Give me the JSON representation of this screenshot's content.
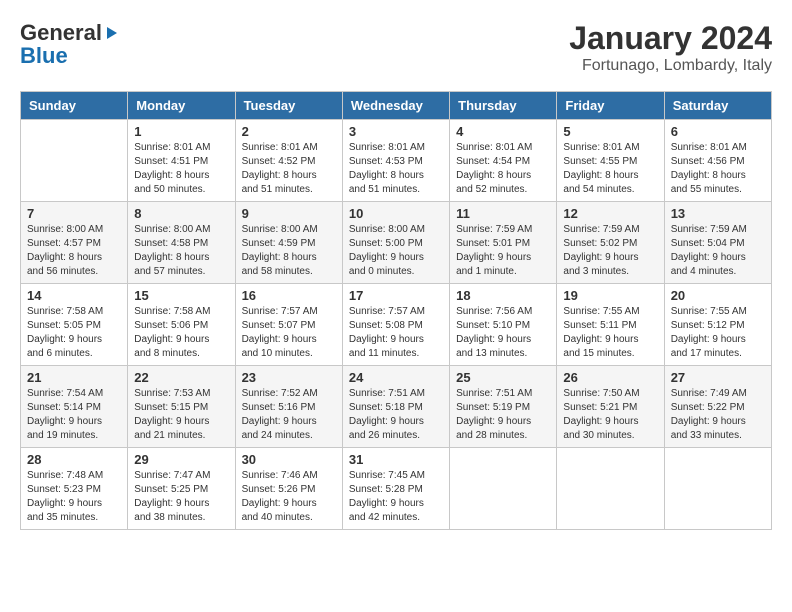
{
  "header": {
    "logo_general": "General",
    "logo_blue": "Blue",
    "month_title": "January 2024",
    "location": "Fortunago, Lombardy, Italy"
  },
  "weekdays": [
    "Sunday",
    "Monday",
    "Tuesday",
    "Wednesday",
    "Thursday",
    "Friday",
    "Saturday"
  ],
  "weeks": [
    [
      {
        "day": "",
        "info": ""
      },
      {
        "day": "1",
        "info": "Sunrise: 8:01 AM\nSunset: 4:51 PM\nDaylight: 8 hours\nand 50 minutes."
      },
      {
        "day": "2",
        "info": "Sunrise: 8:01 AM\nSunset: 4:52 PM\nDaylight: 8 hours\nand 51 minutes."
      },
      {
        "day": "3",
        "info": "Sunrise: 8:01 AM\nSunset: 4:53 PM\nDaylight: 8 hours\nand 51 minutes."
      },
      {
        "day": "4",
        "info": "Sunrise: 8:01 AM\nSunset: 4:54 PM\nDaylight: 8 hours\nand 52 minutes."
      },
      {
        "day": "5",
        "info": "Sunrise: 8:01 AM\nSunset: 4:55 PM\nDaylight: 8 hours\nand 54 minutes."
      },
      {
        "day": "6",
        "info": "Sunrise: 8:01 AM\nSunset: 4:56 PM\nDaylight: 8 hours\nand 55 minutes."
      }
    ],
    [
      {
        "day": "7",
        "info": "Sunrise: 8:00 AM\nSunset: 4:57 PM\nDaylight: 8 hours\nand 56 minutes."
      },
      {
        "day": "8",
        "info": "Sunrise: 8:00 AM\nSunset: 4:58 PM\nDaylight: 8 hours\nand 57 minutes."
      },
      {
        "day": "9",
        "info": "Sunrise: 8:00 AM\nSunset: 4:59 PM\nDaylight: 8 hours\nand 58 minutes."
      },
      {
        "day": "10",
        "info": "Sunrise: 8:00 AM\nSunset: 5:00 PM\nDaylight: 9 hours\nand 0 minutes."
      },
      {
        "day": "11",
        "info": "Sunrise: 7:59 AM\nSunset: 5:01 PM\nDaylight: 9 hours\nand 1 minute."
      },
      {
        "day": "12",
        "info": "Sunrise: 7:59 AM\nSunset: 5:02 PM\nDaylight: 9 hours\nand 3 minutes."
      },
      {
        "day": "13",
        "info": "Sunrise: 7:59 AM\nSunset: 5:04 PM\nDaylight: 9 hours\nand 4 minutes."
      }
    ],
    [
      {
        "day": "14",
        "info": "Sunrise: 7:58 AM\nSunset: 5:05 PM\nDaylight: 9 hours\nand 6 minutes."
      },
      {
        "day": "15",
        "info": "Sunrise: 7:58 AM\nSunset: 5:06 PM\nDaylight: 9 hours\nand 8 minutes."
      },
      {
        "day": "16",
        "info": "Sunrise: 7:57 AM\nSunset: 5:07 PM\nDaylight: 9 hours\nand 10 minutes."
      },
      {
        "day": "17",
        "info": "Sunrise: 7:57 AM\nSunset: 5:08 PM\nDaylight: 9 hours\nand 11 minutes."
      },
      {
        "day": "18",
        "info": "Sunrise: 7:56 AM\nSunset: 5:10 PM\nDaylight: 9 hours\nand 13 minutes."
      },
      {
        "day": "19",
        "info": "Sunrise: 7:55 AM\nSunset: 5:11 PM\nDaylight: 9 hours\nand 15 minutes."
      },
      {
        "day": "20",
        "info": "Sunrise: 7:55 AM\nSunset: 5:12 PM\nDaylight: 9 hours\nand 17 minutes."
      }
    ],
    [
      {
        "day": "21",
        "info": "Sunrise: 7:54 AM\nSunset: 5:14 PM\nDaylight: 9 hours\nand 19 minutes."
      },
      {
        "day": "22",
        "info": "Sunrise: 7:53 AM\nSunset: 5:15 PM\nDaylight: 9 hours\nand 21 minutes."
      },
      {
        "day": "23",
        "info": "Sunrise: 7:52 AM\nSunset: 5:16 PM\nDaylight: 9 hours\nand 24 minutes."
      },
      {
        "day": "24",
        "info": "Sunrise: 7:51 AM\nSunset: 5:18 PM\nDaylight: 9 hours\nand 26 minutes."
      },
      {
        "day": "25",
        "info": "Sunrise: 7:51 AM\nSunset: 5:19 PM\nDaylight: 9 hours\nand 28 minutes."
      },
      {
        "day": "26",
        "info": "Sunrise: 7:50 AM\nSunset: 5:21 PM\nDaylight: 9 hours\nand 30 minutes."
      },
      {
        "day": "27",
        "info": "Sunrise: 7:49 AM\nSunset: 5:22 PM\nDaylight: 9 hours\nand 33 minutes."
      }
    ],
    [
      {
        "day": "28",
        "info": "Sunrise: 7:48 AM\nSunset: 5:23 PM\nDaylight: 9 hours\nand 35 minutes."
      },
      {
        "day": "29",
        "info": "Sunrise: 7:47 AM\nSunset: 5:25 PM\nDaylight: 9 hours\nand 38 minutes."
      },
      {
        "day": "30",
        "info": "Sunrise: 7:46 AM\nSunset: 5:26 PM\nDaylight: 9 hours\nand 40 minutes."
      },
      {
        "day": "31",
        "info": "Sunrise: 7:45 AM\nSunset: 5:28 PM\nDaylight: 9 hours\nand 42 minutes."
      },
      {
        "day": "",
        "info": ""
      },
      {
        "day": "",
        "info": ""
      },
      {
        "day": "",
        "info": ""
      }
    ]
  ]
}
